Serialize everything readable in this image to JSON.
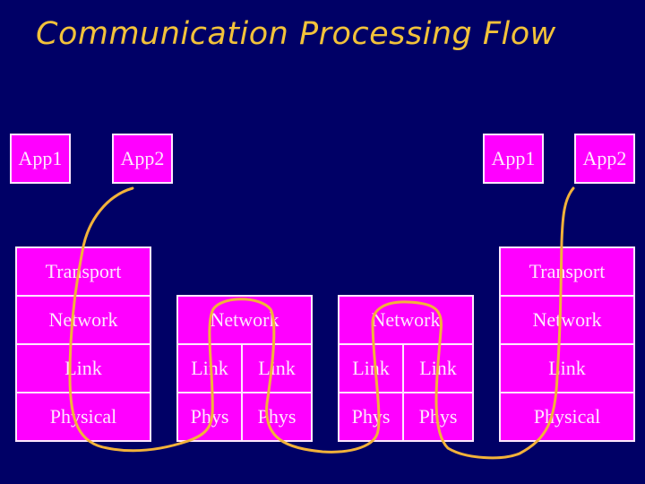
{
  "title": "Communication Processing Flow",
  "colors": {
    "background": "#000066",
    "box_fill": "#ff00ff",
    "box_border": "#ffe8ff",
    "title": "#f2c23a",
    "flow_line": "#f2b23a"
  },
  "left_host": {
    "apps": [
      "App1",
      "App2"
    ],
    "layers": [
      "Transport",
      "Network",
      "Link",
      "Physical"
    ]
  },
  "router_1": {
    "network": "Network",
    "links": [
      "Link",
      "Link"
    ],
    "phys": [
      "Phys",
      "Phys"
    ]
  },
  "router_2": {
    "network": "Network",
    "links": [
      "Link",
      "Link"
    ],
    "phys": [
      "Phys",
      "Phys"
    ]
  },
  "right_host": {
    "apps": [
      "App1",
      "App2"
    ],
    "layers": [
      "Transport",
      "Network",
      "Link",
      "Physical"
    ]
  }
}
